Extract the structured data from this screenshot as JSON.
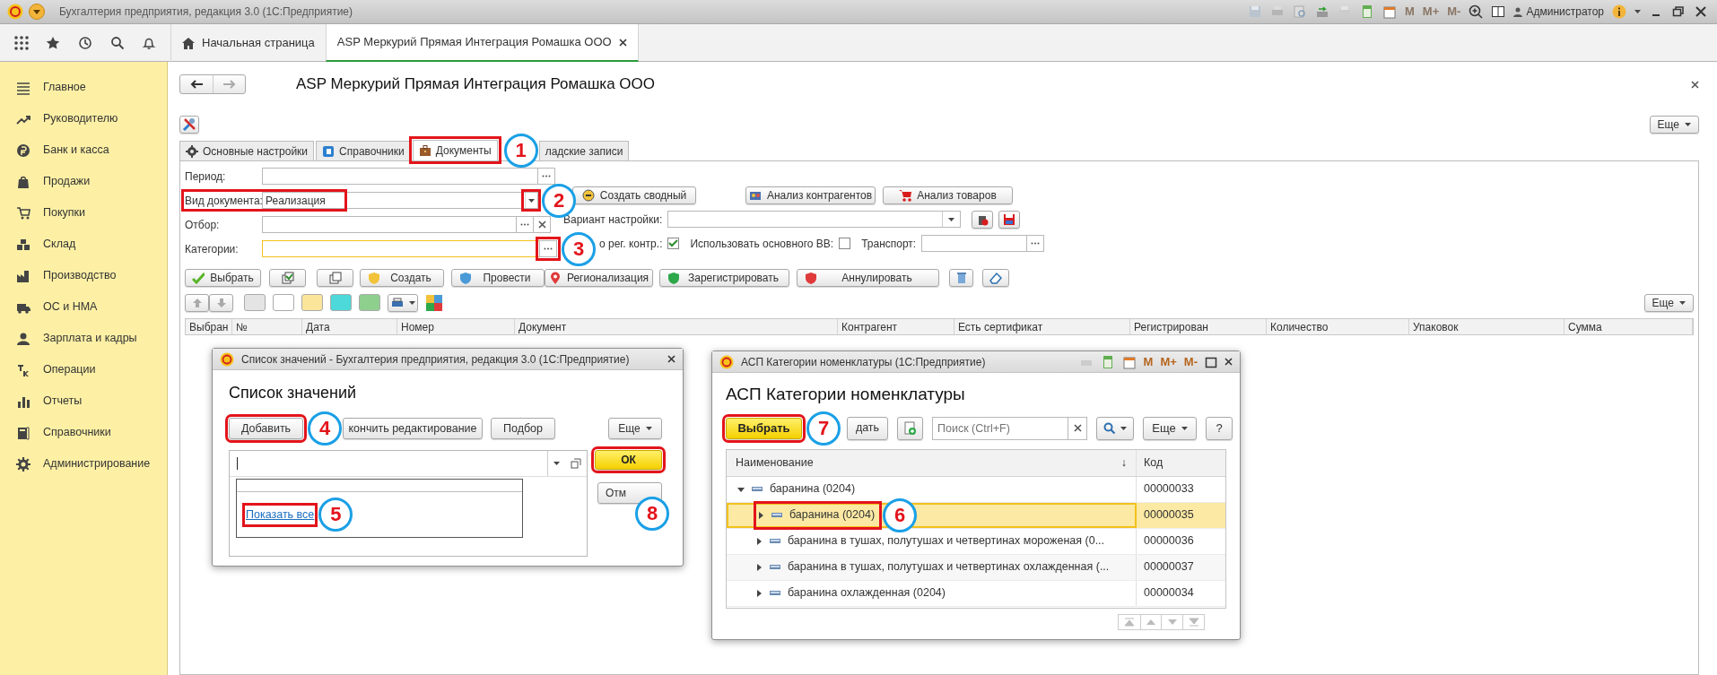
{
  "app": {
    "title": "Бухгалтерия предприятия, редакция 3.0  (1С:Предприятие)",
    "memory_keys": [
      "M",
      "M+",
      "M-"
    ],
    "user": "Администратор"
  },
  "open_tabs": [
    {
      "label": "Начальная страница",
      "selected": false,
      "kind": "home"
    },
    {
      "label": "ASP Меркурий Прямая Интеграция Ромашка ООО",
      "selected": true,
      "kind": "form"
    }
  ],
  "sidebar": [
    {
      "label": "Главное"
    },
    {
      "label": "Руководителю"
    },
    {
      "label": "Банк и касса"
    },
    {
      "label": "Продажи"
    },
    {
      "label": "Покупки"
    },
    {
      "label": "Склад"
    },
    {
      "label": "Производство"
    },
    {
      "label": "ОС и НМА"
    },
    {
      "label": "Зарплата и кадры"
    },
    {
      "label": "Операции"
    },
    {
      "label": "Отчеты"
    },
    {
      "label": "Справочники"
    },
    {
      "label": "Администрирование"
    }
  ],
  "form": {
    "title": "ASP Меркурий Прямая Интеграция Ромашка ООО",
    "more_button": "Еще",
    "tabs": [
      {
        "label": "Основные настройки",
        "selected": false,
        "kind": "gear"
      },
      {
        "label": "Справочники",
        "selected": false,
        "kind": "book"
      },
      {
        "label": "Документы",
        "selected": true,
        "kind": "case",
        "callout": "1"
      },
      {
        "label": "ладские записи",
        "selected": false
      }
    ],
    "fields": [
      {
        "label": "Период:",
        "kind": "period"
      },
      {
        "label": "Вид документа:",
        "value": "Реализация",
        "kind": "choice",
        "highlighted": true,
        "callout": "2"
      },
      {
        "label": "Отбор:",
        "kind": "filter"
      },
      {
        "label": "Категории:",
        "kind": "select",
        "focused": true,
        "callout": "3"
      }
    ],
    "report_buttons": [
      {
        "label": "Создать сводный",
        "kind": "summary"
      },
      {
        "label": "Анализ контрагентов",
        "kind": "partners"
      },
      {
        "label": "Анализ товаров",
        "kind": "goods"
      }
    ],
    "settings_variant": {
      "label": "Вариант настройки:"
    },
    "options": [
      {
        "label": "о рег. контр.:",
        "checked": true
      },
      {
        "label": "Использовать основного ВВ:",
        "checked": false
      }
    ],
    "transport": {
      "label": "Транспорт:"
    },
    "actions": [
      {
        "label": "Выбрать",
        "kind": "select"
      },
      {
        "kind": "check-all"
      },
      {
        "kind": "copy"
      },
      {
        "label": "Создать",
        "kind": "create"
      },
      {
        "label": "Провести",
        "kind": "post"
      },
      {
        "label": "Регионализация",
        "kind": "region"
      },
      {
        "label": "Зарегистрировать",
        "kind": "register"
      },
      {
        "label": "Аннулировать",
        "kind": "annul"
      },
      {
        "kind": "delete"
      },
      {
        "kind": "clear"
      }
    ],
    "swatches": [
      {
        "color": "#e4e4e4"
      },
      {
        "color": "#ffffff"
      },
      {
        "color": "#fbe59b"
      },
      {
        "color": "#4dd9d9"
      },
      {
        "color": "#8ecf8e"
      }
    ],
    "table_more_button": "Еще",
    "columns": [
      "Выбран",
      "№",
      "Дата",
      "Номер",
      "Документ",
      "Контрагент",
      "Есть сертификат",
      "Регистрирован",
      "Количество",
      "Упаковок",
      "Сумма"
    ]
  },
  "value_list": {
    "window_title": "Список значений - Бухгалтерия предприятия, редакция 3.0  (1С:Предприятие)",
    "heading": "Список значений",
    "buttons": [
      {
        "label": "Добавить",
        "callout": "4"
      },
      {
        "label": "кончить редактирование"
      },
      {
        "label": "Подбор"
      }
    ],
    "more_button": "Еще",
    "ok_button": {
      "label": "ОК",
      "callout": "8"
    },
    "cancel_button": "Отм",
    "dropdown_link": {
      "label": "Показать все",
      "callout": "5"
    }
  },
  "categories": {
    "window_title": "АСП Категории номенклатуры  (1С:Предприятие)",
    "memory_keys": [
      "M",
      "M+",
      "M-"
    ],
    "heading": "АСП Категории номенклатуры",
    "select_button": {
      "label": "Выбрать",
      "callout": "7"
    },
    "create_button": "дать",
    "search": {
      "placeholder": "Поиск (Ctrl+F)"
    },
    "more_button": "Еще",
    "help_button": "?",
    "columns": [
      "Наименование",
      "Код"
    ],
    "sort_mark": "↓",
    "rows": [
      {
        "name": "баранина (0204)",
        "code": "00000033",
        "expanded": true,
        "selected": false,
        "children": [
          {
            "name": "баранина (0204)",
            "code": "00000035",
            "expanded": false,
            "selected": true,
            "callout": "6"
          },
          {
            "name": "баранина в тушах, полутушах и четвертинах мороженая (0...",
            "code": "00000036",
            "expanded": false,
            "selected": false
          },
          {
            "name": "баранина в тушах, полутушах и четвертинах охлажденная (...",
            "code": "00000037",
            "expanded": false,
            "selected": false
          },
          {
            "name": "баранина охлажденная (0204)",
            "code": "00000034",
            "expanded": false,
            "selected": false
          }
        ]
      }
    ]
  }
}
